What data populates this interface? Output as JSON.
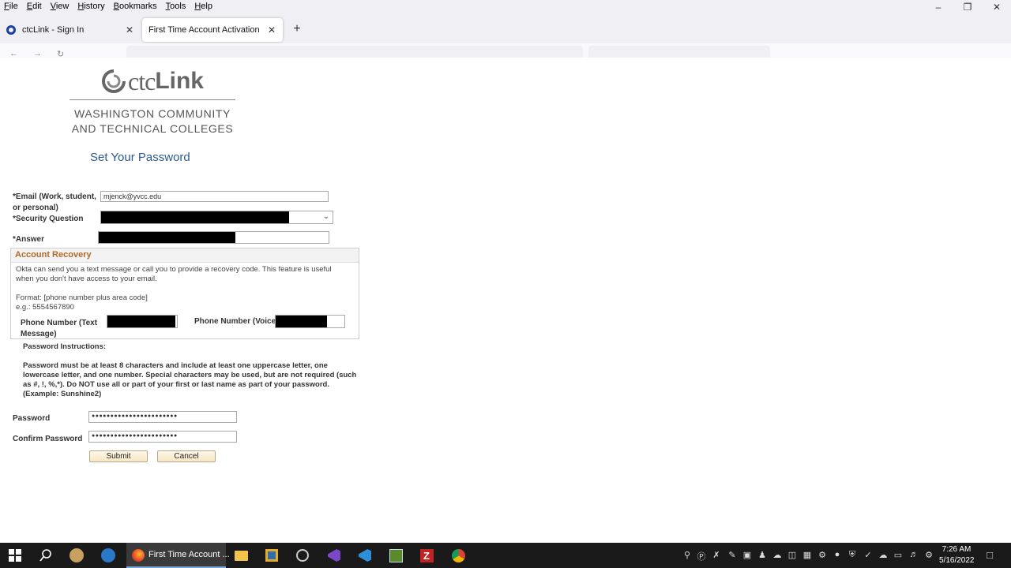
{
  "menubar": {
    "items": [
      "File",
      "Edit",
      "View",
      "History",
      "Bookmarks",
      "Tools",
      "Help"
    ]
  },
  "tabs": [
    {
      "label": "ctcLink - Sign In"
    },
    {
      "label": "First Time Account Activation"
    }
  ],
  "logo": {
    "brand_ctc": "ctc",
    "brand_link": "Link",
    "line1": "WASHINGTON COMMUNITY",
    "line2": "AND TECHNICAL COLLEGES"
  },
  "page": {
    "title": "Set Your Password"
  },
  "form": {
    "email_label_1": "*Email (Work, student,",
    "email_label_2": "or personal)",
    "email_value": "mjenck@yvcc.edu",
    "security_question_label": "*Security Question",
    "answer_label": "*Answer"
  },
  "recovery": {
    "heading": "Account Recovery",
    "desc_1": "Okta can send you a text message or call you to provide a recovery code. This feature is useful",
    "desc_2": "when you don't have access to your email.",
    "format_1": "Format: [phone number plus area code]",
    "format_2": "e.g.: 5554567890",
    "phone_text_label_1": "Phone Number (Text",
    "phone_text_label_2": "Message)",
    "phone_voice_label": "Phone Number (Voice)"
  },
  "instructions": {
    "heading": "Password Instructions:",
    "line1": "Password must be at least 8 characters and include at least one uppercase letter, one",
    "line2": "lowercase letter, and one number. Special characters may be used, but are not required (such",
    "line3": "as #, !, %,*). Do NOT use all or part of your first or last name as part of your password.",
    "line4": "(Example: Sunshine2)"
  },
  "password": {
    "label": "Password",
    "value": "●●●●●●●●●●●●●●●●●●●●●●●",
    "confirm_label": "Confirm Password",
    "confirm_value": "●●●●●●●●●●●●●●●●●●●●●●●"
  },
  "buttons": {
    "submit": "Submit",
    "cancel": "Cancel"
  },
  "taskbar": {
    "active_app_label": "First Time Account ...",
    "time": "7:26 AM",
    "date": "5/16/2022"
  },
  "colors": {
    "title_blue": "#2d5a8e",
    "recovery_heading": "#b06a2a",
    "button_fill": "#f6e6c4"
  }
}
